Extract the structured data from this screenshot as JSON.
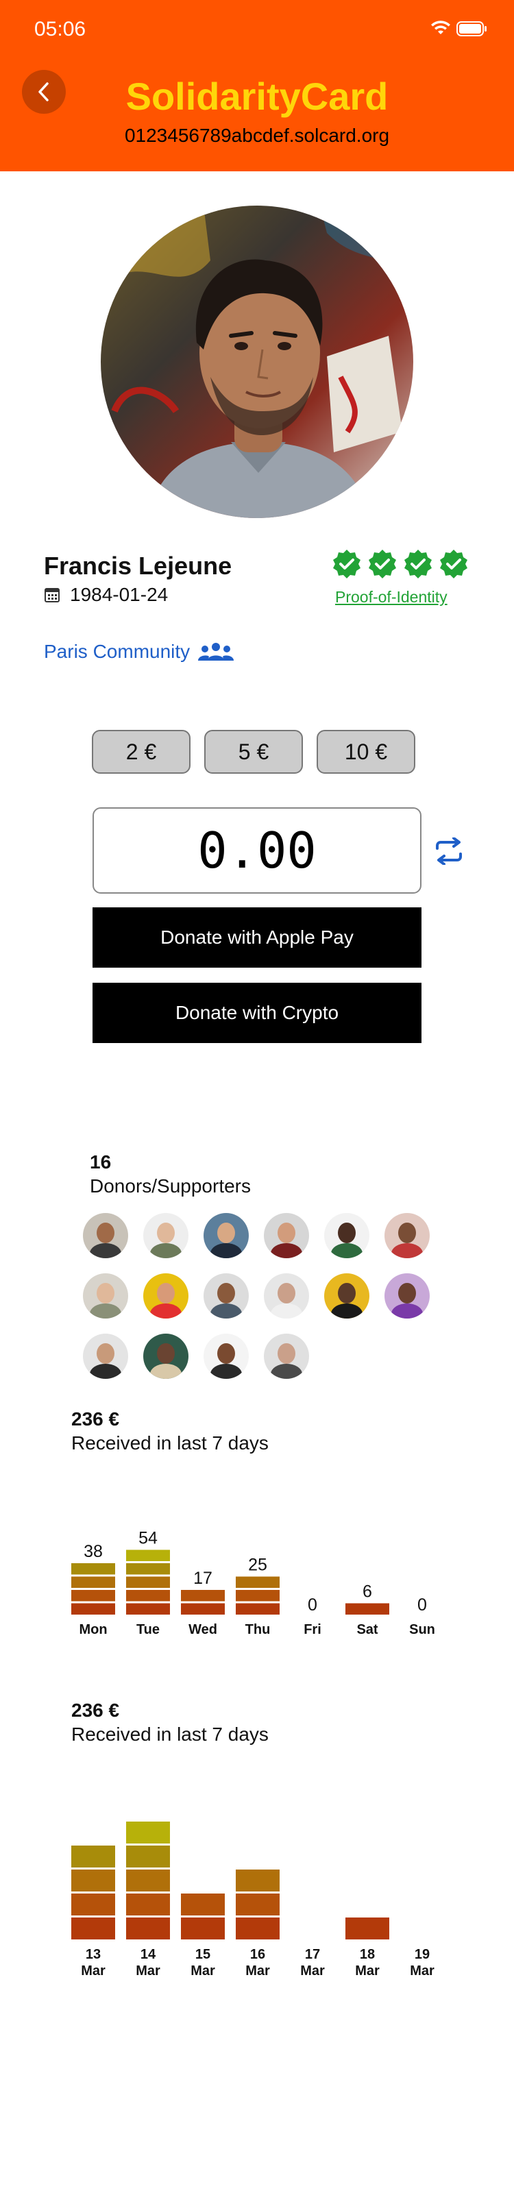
{
  "status_bar": {
    "time": "05:06"
  },
  "header": {
    "title": "SolidarityCard",
    "url": "0123456789abcdef.solcard.org"
  },
  "profile": {
    "name": "Francis Lejeune",
    "birthdate": "1984-01-24",
    "verification_count": 4,
    "proof_label": "Proof-of-Identity",
    "community": "Paris Community"
  },
  "donation": {
    "presets": [
      "2 €",
      "5 €",
      "10 €"
    ],
    "amount": "0.00",
    "apple_pay_label": "Donate with Apple Pay",
    "crypto_label": "Donate with Crypto"
  },
  "donors": {
    "count": "16",
    "label": "Donors/Supporters"
  },
  "colors": {
    "header_bg": "#ff5400",
    "title_color": "#ffd60a",
    "verified_green": "#22a336",
    "link_blue": "#1f5fc8",
    "bar_levels": [
      "#b33a0a",
      "#b5520a",
      "#b0700a",
      "#a88c0a",
      "#b7b10a",
      "#8fb20a"
    ]
  },
  "stats_days": {
    "amount": "236 €",
    "label": "Received in last 7 days"
  },
  "stats_dates": {
    "amount": "236 €",
    "label": "Received in last 7 days"
  },
  "chart_data": [
    {
      "type": "bar",
      "categories": [
        "Mon",
        "Tue",
        "Wed",
        "Thu",
        "Fri",
        "Sat",
        "Sun"
      ],
      "values": [
        38,
        54,
        17,
        25,
        0,
        6,
        0
      ],
      "data_labels": true,
      "title": "",
      "xlabel": "",
      "ylabel": ""
    },
    {
      "type": "bar",
      "categories": [
        "13 Mar",
        "14 Mar",
        "15 Mar",
        "16 Mar",
        "17 Mar",
        "18 Mar",
        "19 Mar"
      ],
      "values": [
        38,
        54,
        17,
        25,
        0,
        6,
        0
      ],
      "data_labels": false,
      "title": "",
      "xlabel": "",
      "ylabel": ""
    }
  ]
}
